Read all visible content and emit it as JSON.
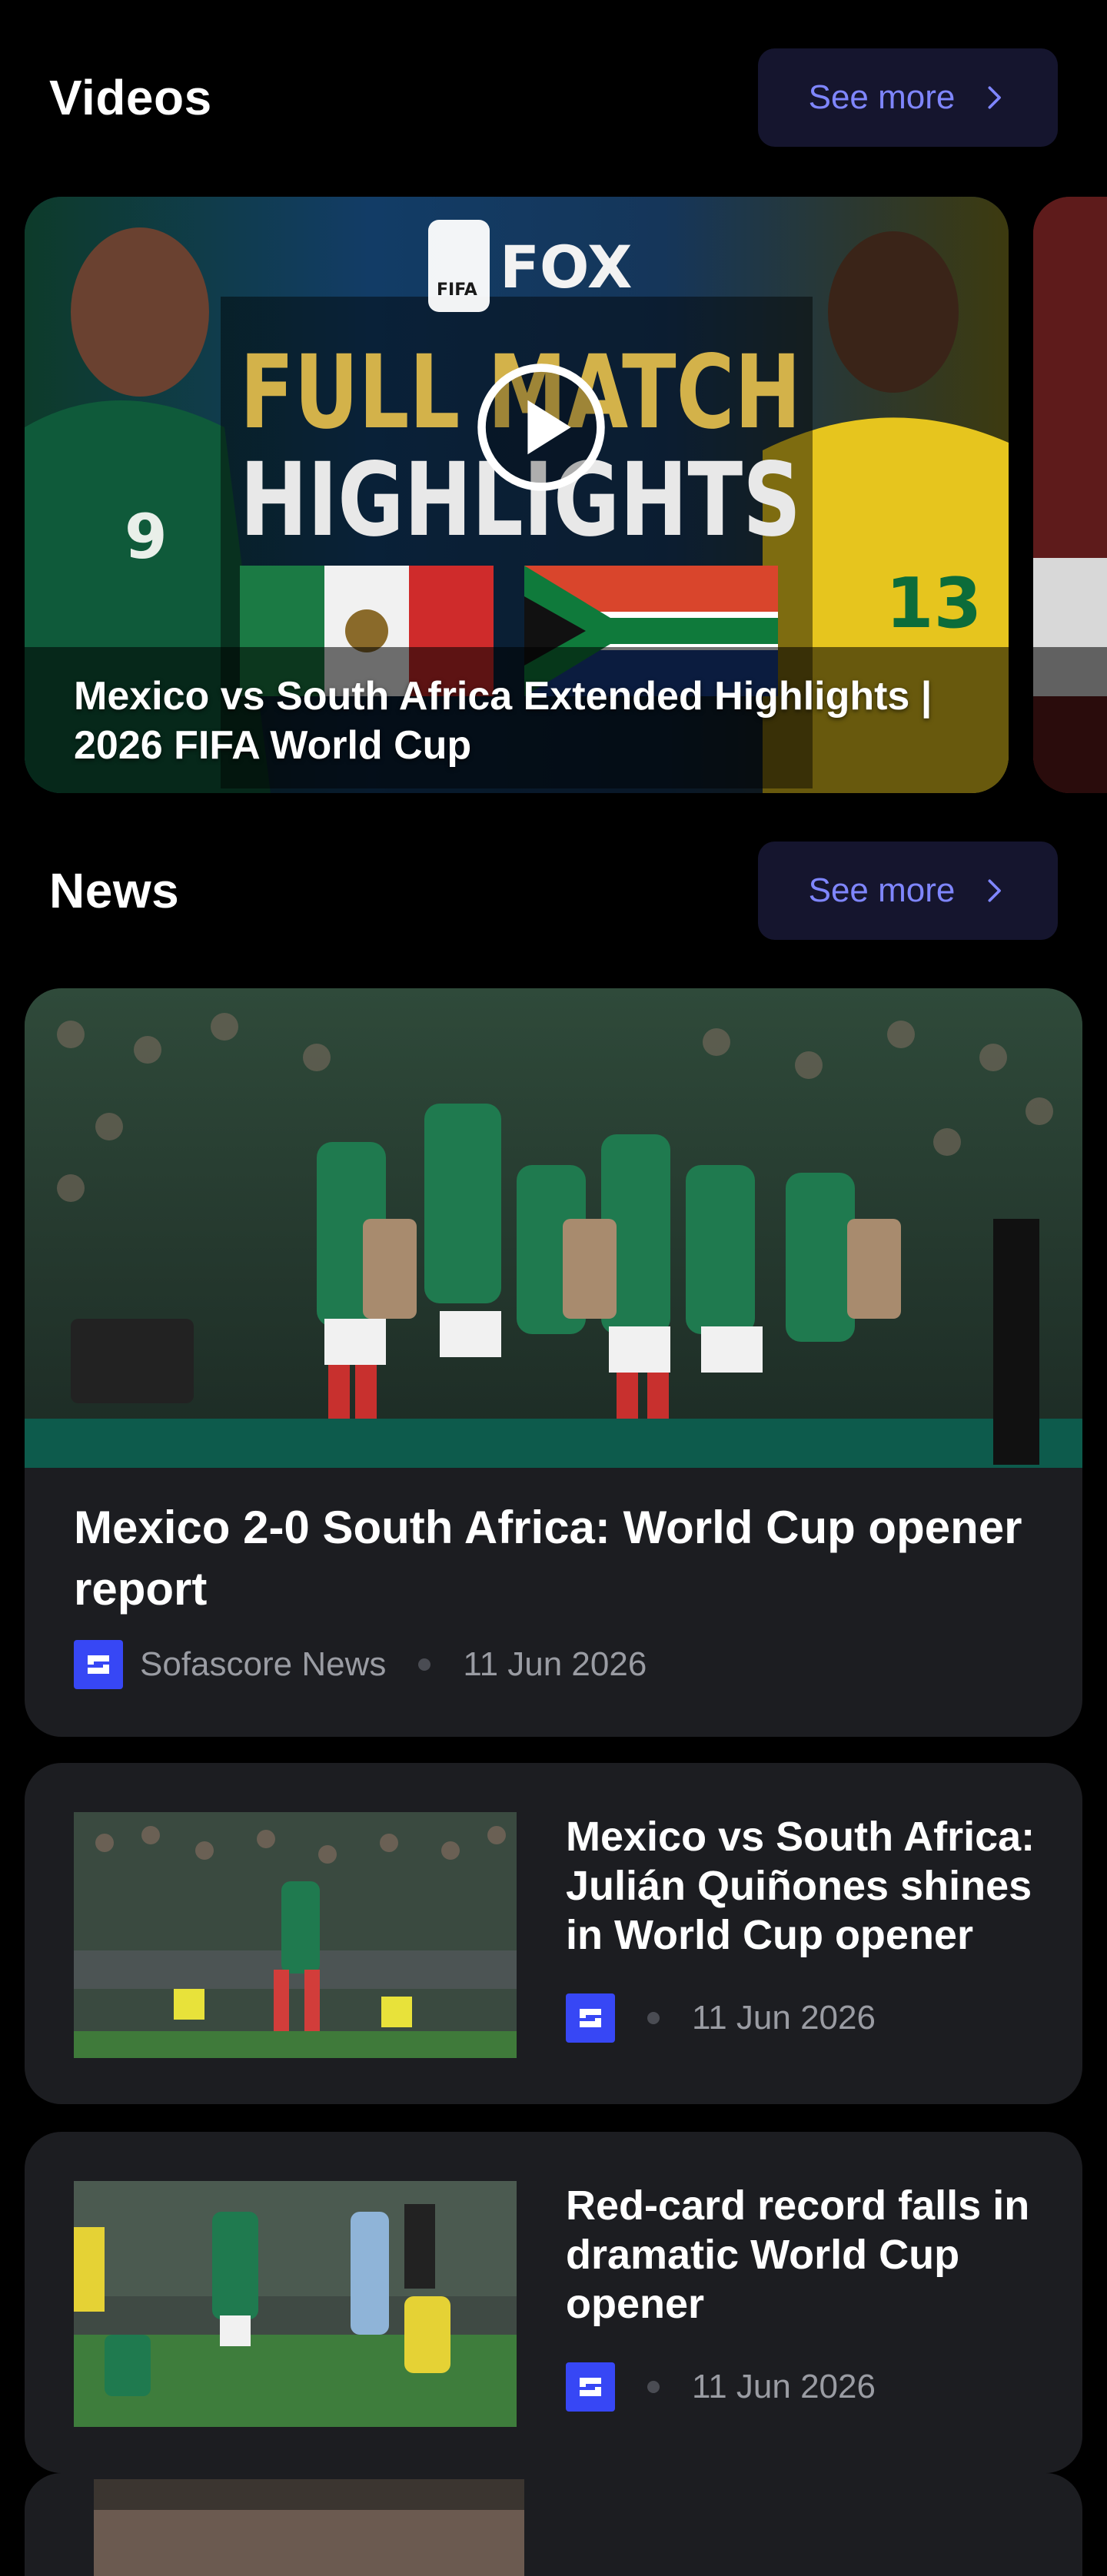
{
  "videos": {
    "title": "Videos",
    "see_more": "See more",
    "items": [
      {
        "title": "Mexico vs South Africa Extended Highlights | 2026 FIFA World Cup",
        "thumb_text": {
          "brand": "FOX",
          "line1": "FULL MATCH",
          "line2": "HIGHLIGHTS",
          "badge": "FIFA",
          "shirt_left": "9",
          "shirt_right": "13"
        }
      }
    ]
  },
  "news": {
    "title": "News",
    "see_more": "See more",
    "featured": {
      "title": "Mexico 2-0 South Africa: World Cup opener report",
      "source": "Sofascore News",
      "date": "11 Jun 2026"
    },
    "items": [
      {
        "title": "Mexico vs South Africa: Julián Quiñones shines in World Cup opener",
        "date": "11 Jun 2026"
      },
      {
        "title": "Red-card record falls in dramatic World Cup opener",
        "date": "11 Jun 2026"
      }
    ]
  },
  "colors": {
    "accent": "#7f86ff",
    "card_bg": "#1c1d21",
    "see_more_bg": "#15152e",
    "logo_blue": "#3747f5"
  }
}
